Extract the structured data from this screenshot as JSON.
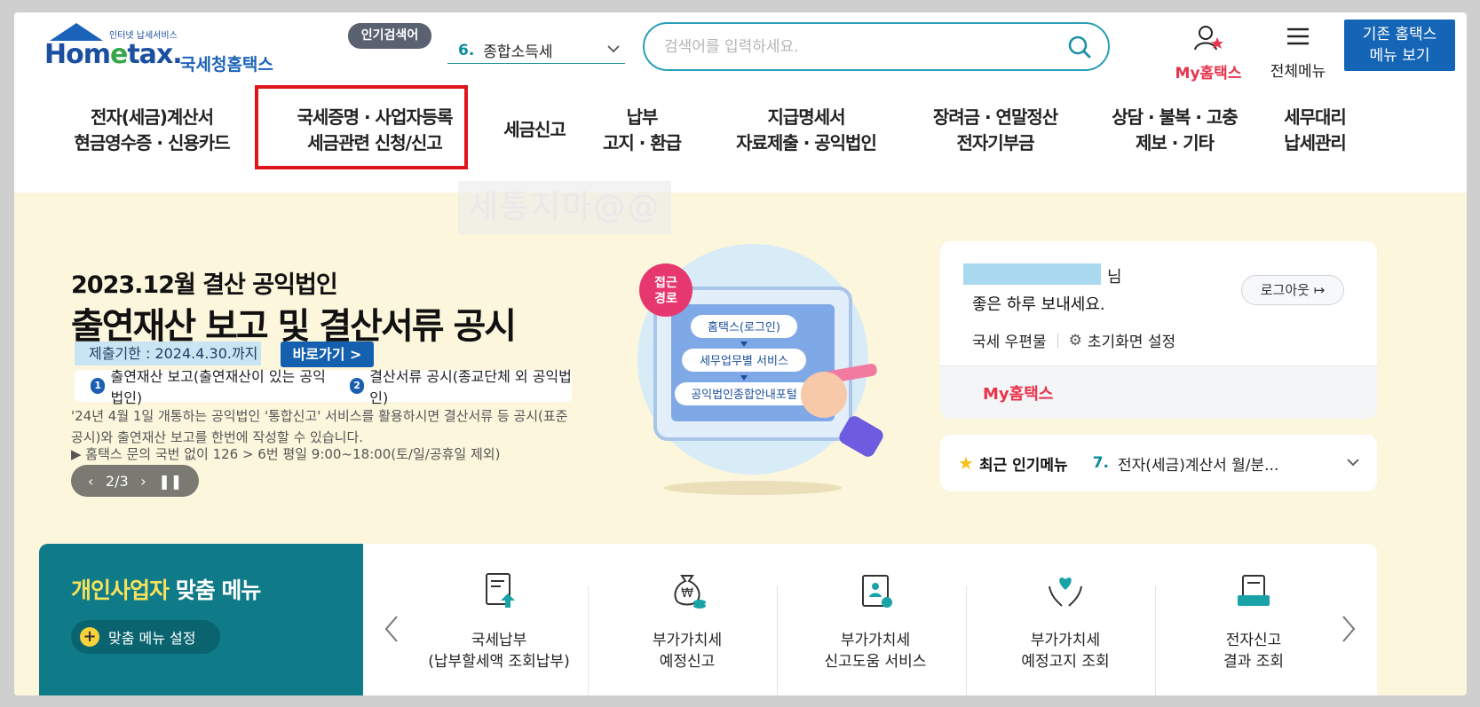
{
  "header": {
    "logo_small": "인터넷 납세서비스",
    "logo_main": "Hometax.",
    "logo_sub": "국세청홈택스",
    "popular_badge": "인기검색어",
    "popular_rank": "6.",
    "popular_term": "종합소득세",
    "search_placeholder": "검색어를 입력하세요.",
    "my_hometax": "My홈택스",
    "all_menu": "전체메뉴",
    "old_menu_line1": "기존 홈택스",
    "old_menu_line2": "메뉴 보기"
  },
  "nav": [
    {
      "line1": "전자(세금)계산서",
      "line2": "현금영수증 · 신용카드"
    },
    {
      "line1": "국세증명 · 사업자등록",
      "line2": "세금관련 신청/신고"
    },
    {
      "line1": "세금신고",
      "line2": ""
    },
    {
      "line1": "납부",
      "line2": "고지 · 환급"
    },
    {
      "line1": "지급명세서",
      "line2": "자료제출 · 공익법인"
    },
    {
      "line1": "장려금 · 연말정산",
      "line2": "전자기부금"
    },
    {
      "line1": "상담 · 불복 · 고충",
      "line2": "제보 · 기타"
    },
    {
      "line1": "세무대리",
      "line2": "납세관리"
    }
  ],
  "watermark": "세통지마@@",
  "banner": {
    "subtitle": "2023.12월 결산 공익법인",
    "title": "출연재산 보고 및 결산서류 공시",
    "deadline": "제출기한 : 2024.4.30.까지",
    "go_button": "바로가기 >",
    "item1_num": "1",
    "item1": "출연재산 보고(출연재산이 있는 공익법인)",
    "item2_num": "2",
    "item2": "결산서류 공시(종교단체 외 공익법인)",
    "note1": "'24년 4월 1일 개통하는 공익법인 '통합신고' 서비스를 활용하시면 결산서류 등 공시(표준공시)와 출연재산 보고를 한번에 작성할 수 있습니다.",
    "note2": "▶ 홈택스 문의 국번 없이 126 > 6번 평일 9:00~18:00(토/일/공휴일 제외)",
    "pager": "2/3",
    "illus_badge": "접근 경로",
    "illus_step1": "홈택스(로그인)",
    "illus_step2": "세무업무별 서비스",
    "illus_step3": "공익법인종합안내포털"
  },
  "user_card": {
    "suffix": "님",
    "greeting": "좋은 하루 보내세요.",
    "logout": "로그아웃",
    "mail": "국세 우편물",
    "home_setting": "초기화면 설정",
    "my_hometax": "My홈택스"
  },
  "popular_menu": {
    "title": "최근 인기메뉴",
    "rank": "7.",
    "value": "전자(세금)계산서 월/분..."
  },
  "custom_menu": {
    "title_accent": "개인사업자",
    "title_rest": " 맞춤 메뉴",
    "set_button": "맞춤 메뉴 설정",
    "items": [
      {
        "line1": "국세납부",
        "line2": "(납부할세액 조회납부)"
      },
      {
        "line1": "부가가치세",
        "line2": "예정신고"
      },
      {
        "line1": "부가가치세",
        "line2": "신고도움 서비스"
      },
      {
        "line1": "부가가치세",
        "line2": "예정고지 조회"
      },
      {
        "line1": "전자신고",
        "line2": "결과 조회"
      }
    ]
  },
  "colors": {
    "brand_blue": "#1565b7",
    "accent_teal": "#0f7a88",
    "highlight_red": "#e0151c",
    "my_red": "#e8334a"
  }
}
